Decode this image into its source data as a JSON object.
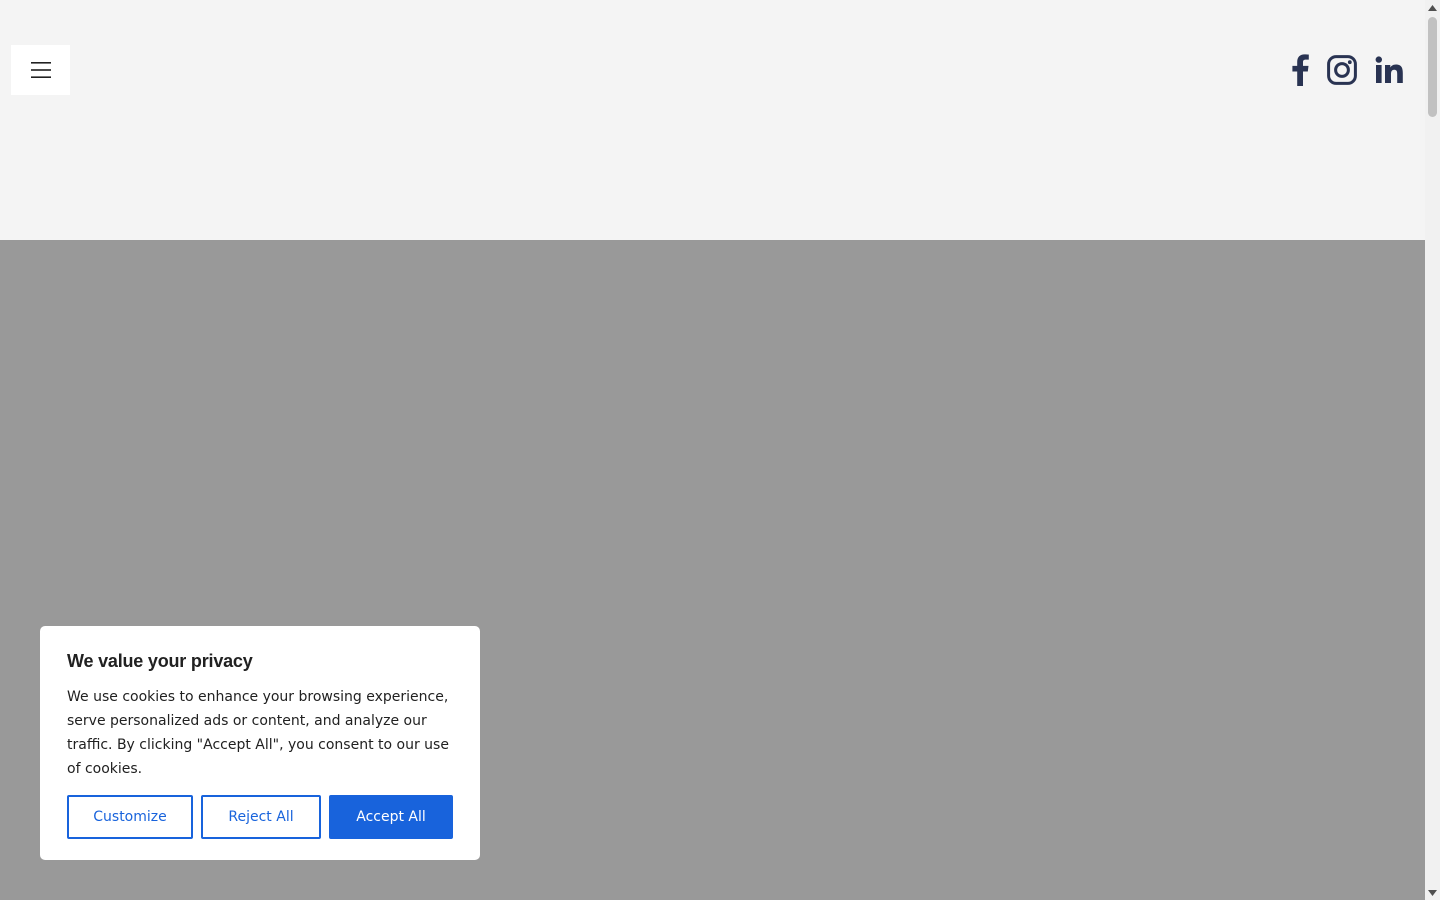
{
  "header": {
    "menu_icon": "hamburger-menu-icon",
    "social": [
      {
        "name": "facebook",
        "icon": "facebook-icon"
      },
      {
        "name": "instagram",
        "icon": "instagram-icon"
      },
      {
        "name": "linkedin",
        "icon": "linkedin-icon"
      }
    ],
    "icon_color": "#293352"
  },
  "hero": {
    "background": "#999999"
  },
  "cookie_banner": {
    "title": "We value your privacy",
    "text": "We use cookies to enhance your browsing experience, serve personalized ads or content, and analyze our traffic. By clicking \"Accept All\", you consent to our use of cookies.",
    "customize_label": "Customize",
    "reject_label": "Reject All",
    "accept_label": "Accept All",
    "accent_color": "#1863dc"
  }
}
